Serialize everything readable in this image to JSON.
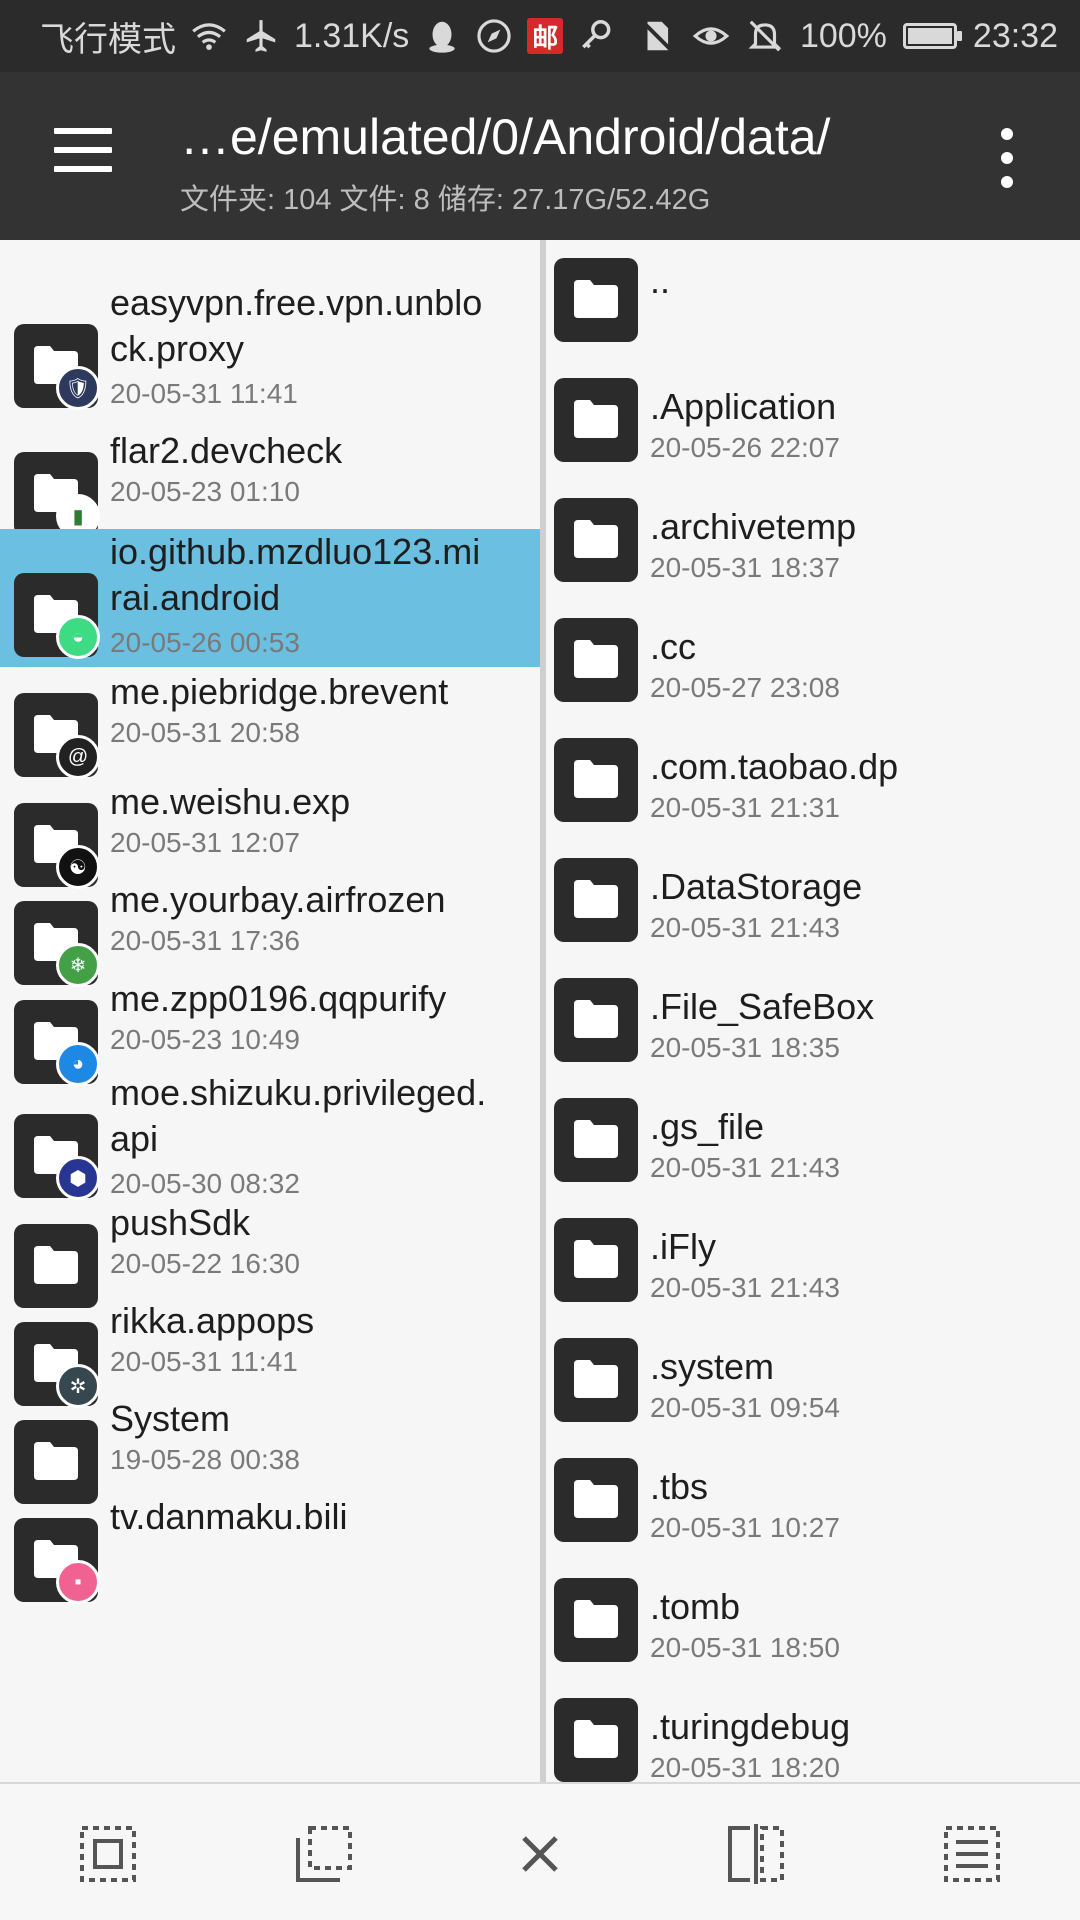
{
  "status_bar": {
    "left_text": "飞行模式",
    "speed": "1.31K/s",
    "post_badge": "邮",
    "battery": "100%",
    "time": "23:32"
  },
  "toolbar": {
    "path": "…e/emulated/0/Android/data/",
    "summary": "文件夹: 104  文件: 8  储存: 27.17G/52.42G"
  },
  "left_pane": {
    "items": [
      {
        "name_l1": "easyvpn.free.vpn.unblo",
        "name_l2": "ck.proxy",
        "date": "20-05-31 11:41",
        "badge_icon": "shield-icon",
        "badge_color": "#2d3a5e"
      },
      {
        "name_l1": "flar2.devcheck",
        "name_l2": "",
        "date": "20-05-23 01:10",
        "badge_icon": "chip-icon",
        "badge_color": "#ffffff"
      },
      {
        "name_l1": "io.github.mzdluo123.mi",
        "name_l2": "rai.android",
        "date": "20-05-26 00:53",
        "badge_icon": "android-icon",
        "badge_color": "#3ddc84"
      },
      {
        "name_l1": "me.piebridge.brevent",
        "name_l2": "",
        "date": "20-05-31 20:58",
        "badge_icon": "spiral-icon",
        "badge_color": "#222222"
      },
      {
        "name_l1": "me.weishu.exp",
        "name_l2": "",
        "date": "20-05-31 12:07",
        "badge_icon": "yin-yang-icon",
        "badge_color": "#111111"
      },
      {
        "name_l1": "me.yourbay.airfrozen",
        "name_l2": "",
        "date": "20-05-31 17:36",
        "badge_icon": "snowflake-icon",
        "badge_color": "#43a047"
      },
      {
        "name_l1": "me.zpp0196.qqpurify",
        "name_l2": "",
        "date": "20-05-23 10:49",
        "badge_icon": "penguin-icon",
        "badge_color": "#1e88e5"
      },
      {
        "name_l1": "moe.shizuku.privileged.",
        "name_l2": "api",
        "date": "20-05-30 08:32",
        "badge_icon": "hexagon-icon",
        "badge_color": "#283593"
      },
      {
        "name_l1": "pushSdk",
        "name_l2": "",
        "date": "20-05-22 16:30",
        "badge_icon": "",
        "badge_color": ""
      },
      {
        "name_l1": "rikka.appops",
        "name_l2": "",
        "date": "20-05-31 11:41",
        "badge_icon": "gear-icon",
        "badge_color": "#37474f"
      },
      {
        "name_l1": "System",
        "name_l2": "",
        "date": "19-05-28 00:38",
        "badge_icon": "",
        "badge_color": ""
      },
      {
        "name_l1": "tv.danmaku.bili",
        "name_l2": "",
        "date": "",
        "badge_icon": "bili-icon",
        "badge_color": "#f06292"
      }
    ]
  },
  "right_pane": {
    "items": [
      {
        "name": "..",
        "date": ""
      },
      {
        "name": ".Application",
        "date": "20-05-26 22:07"
      },
      {
        "name": ".archivetemp",
        "date": "20-05-31 18:37"
      },
      {
        "name": ".cc",
        "date": "20-05-27 23:08"
      },
      {
        "name": ".com.taobao.dp",
        "date": "20-05-31 21:31"
      },
      {
        "name": ".DataStorage",
        "date": "20-05-31 21:43"
      },
      {
        "name": ".File_SafeBox",
        "date": "20-05-31 18:35"
      },
      {
        "name": ".gs_file",
        "date": "20-05-31 21:43"
      },
      {
        "name": ".iFly",
        "date": "20-05-31 21:43"
      },
      {
        "name": ".system",
        "date": "20-05-31 09:54"
      },
      {
        "name": ".tbs",
        "date": "20-05-31 10:27"
      },
      {
        "name": ".tomb",
        "date": "20-05-31 18:50"
      },
      {
        "name": ".turingdebug",
        "date": "20-05-31 18:20"
      }
    ]
  },
  "bottom_bar": {
    "icons": [
      "select-all-icon",
      "select-partial-icon",
      "close-icon",
      "split-view-icon",
      "list-view-icon"
    ]
  },
  "colors": {
    "selected_row": "#6bbfe0",
    "toolbar_bg": "#333333",
    "status_bg": "#2b2b2b"
  }
}
